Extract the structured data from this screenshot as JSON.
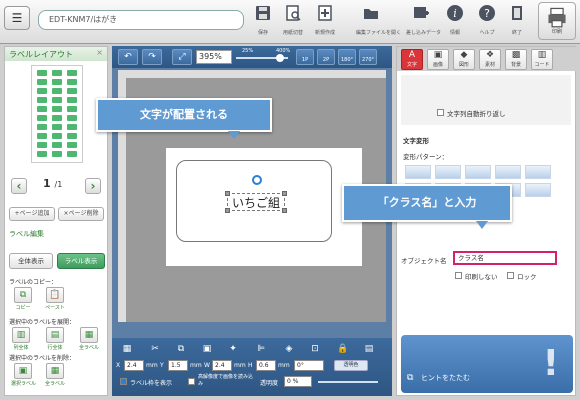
{
  "header": {
    "doc_name": "EDT-KNM7/はがき",
    "buttons": [
      {
        "label": "保存",
        "icon": "save-icon"
      },
      {
        "label": "用紙切替",
        "icon": "paper-switch-icon"
      },
      {
        "label": "新規作成",
        "icon": "new-document-icon"
      },
      {
        "label": "編集ファイルを開く",
        "icon": "open-file-icon"
      },
      {
        "label": "差し込みデータ",
        "icon": "merge-data-icon"
      },
      {
        "label": "情報",
        "icon": "info-icon"
      },
      {
        "label": "ヘルプ",
        "icon": "help-icon"
      },
      {
        "label": "終了",
        "icon": "exit-icon"
      }
    ],
    "print_label": "印刷"
  },
  "left": {
    "title": "ラベルレイアウト",
    "close": "×",
    "page": "1",
    "page_total": "/1",
    "add_page": "+ページ追加",
    "del_page": "×ページ削除",
    "edit_title": "ラベル編集",
    "show_all": "全体表示",
    "show_label": "ラベル表示",
    "copy_label": "ラベルのコピー：",
    "copy": "コピー",
    "paste": "ペースト",
    "expand_label": "選択中のラベルを展開：",
    "col": "列全体",
    "row": "行全体",
    "all": "全ラベル",
    "delete_label": "選択中のラベルを削除：",
    "sel": "選択ラベル",
    "all_del": "全ラベル"
  },
  "editor": {
    "zoom": "395%",
    "zoom_min": "25%",
    "zoom_max": "400%",
    "views": [
      "1P",
      "2P",
      "180°",
      "270°"
    ],
    "callout_main": "文字が配置される",
    "label_text": "いちご組",
    "x": "2.4",
    "y": "1.5",
    "w": "2.4",
    "h": "0.6",
    "angle": "0°",
    "unit": "mm",
    "x_lab": "X",
    "y_lab": "Y",
    "w_lab": "W",
    "h_lab": "H",
    "transparent": "透明色",
    "show_frame": "ラベル枠を表示",
    "hires": "高解像度で画像を読み込み",
    "opacity_label": "透明度",
    "opacity": "0 %"
  },
  "right": {
    "tabs": [
      "文字",
      "画像",
      "図形",
      "素材",
      "背景",
      "コード"
    ],
    "auto_wrap": "文字列自動折り返し",
    "deform": "文字変形",
    "deform_pattern": "変形パターン：",
    "callout_input": "「クラス名」と入力",
    "obj_label": "オブジェクト名",
    "obj_value": "クラス名",
    "no_print": "印刷しない",
    "lock": "ロック",
    "hint_close": "ヒントをたたむ"
  },
  "colors": {
    "accent_green": "#4fb870",
    "editor_blue": "#2e5683",
    "active_tab": "#d9353b",
    "highlight": "#d6216a",
    "callout": "#5f9ad3"
  }
}
